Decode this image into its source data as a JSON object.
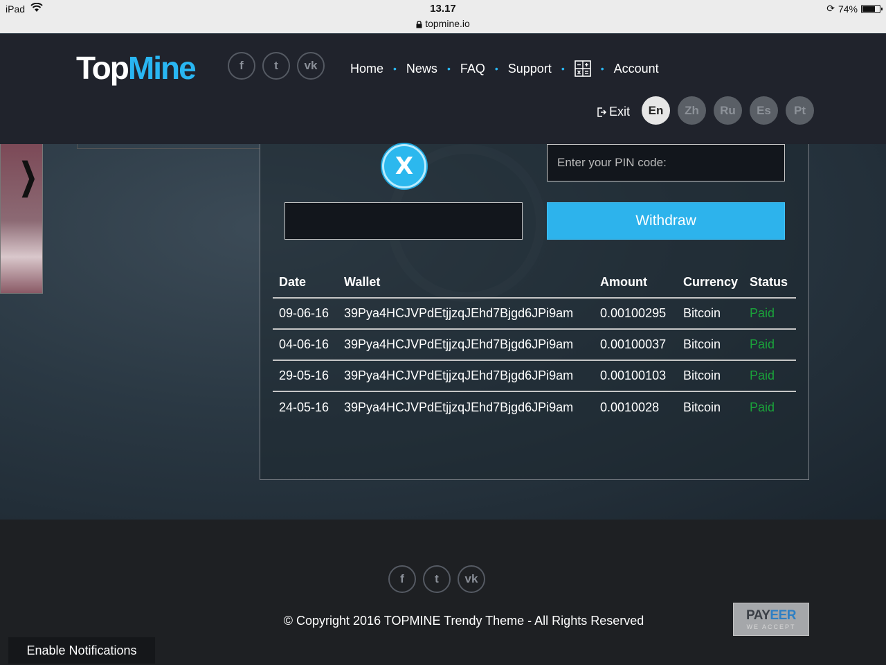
{
  "statusbar": {
    "device": "iPad",
    "time": "13.17",
    "url": "topmine.io",
    "battery": "74%",
    "battery_level": 0.74
  },
  "logo": {
    "part1": "Top",
    "part2": "Mine"
  },
  "social": {
    "facebook": "f",
    "twitter": "t",
    "vk": "vk"
  },
  "nav": [
    {
      "label": "Home"
    },
    {
      "label": "News"
    },
    {
      "label": "FAQ"
    },
    {
      "label": "Support"
    },
    {
      "label": "Account"
    }
  ],
  "header": {
    "exit_label": "Exit"
  },
  "languages": [
    {
      "label": "En",
      "active": true
    },
    {
      "label": "Zh",
      "active": false
    },
    {
      "label": "Ru",
      "active": false
    },
    {
      "label": "Es",
      "active": false
    },
    {
      "label": "Pt",
      "active": false
    }
  ],
  "withdraw_form": {
    "coin_symbol": "X",
    "pin_placeholder": "Enter your PIN code:",
    "amount_value": "",
    "withdraw_label": "Withdraw"
  },
  "table": {
    "columns": [
      "Date",
      "Wallet",
      "Amount",
      "Currency",
      "Status"
    ],
    "rows": [
      {
        "date": "09-06-16",
        "wallet": "39Pya4HCJVPdEtjjzqJEhd7Bjgd6JPi9am",
        "amount": "0.00100295",
        "currency": "Bitcoin",
        "status": "Paid"
      },
      {
        "date": "04-06-16",
        "wallet": "39Pya4HCJVPdEtjjzqJEhd7Bjgd6JPi9am",
        "amount": "0.00100037",
        "currency": "Bitcoin",
        "status": "Paid"
      },
      {
        "date": "29-05-16",
        "wallet": "39Pya4HCJVPdEtjjzqJEhd7Bjgd6JPi9am",
        "amount": "0.00100103",
        "currency": "Bitcoin",
        "status": "Paid"
      },
      {
        "date": "24-05-16",
        "wallet": "39Pya4HCJVPdEtjjzqJEhd7Bjgd6JPi9am",
        "amount": "0.0010028",
        "currency": "Bitcoin",
        "status": "Paid"
      }
    ]
  },
  "footer": {
    "copyright": "© Copyright 2016 TOPMINE Trendy Theme - All Rights Reserved",
    "payeer_pay": "PAY",
    "payeer_eer": "EER",
    "payeer_sub": "WE ACCEPT"
  },
  "notifications": {
    "label": "Enable Notifications"
  },
  "colors": {
    "accent": "#29b6f2",
    "paid": "#1aa33a",
    "header_bg": "#20232c"
  }
}
